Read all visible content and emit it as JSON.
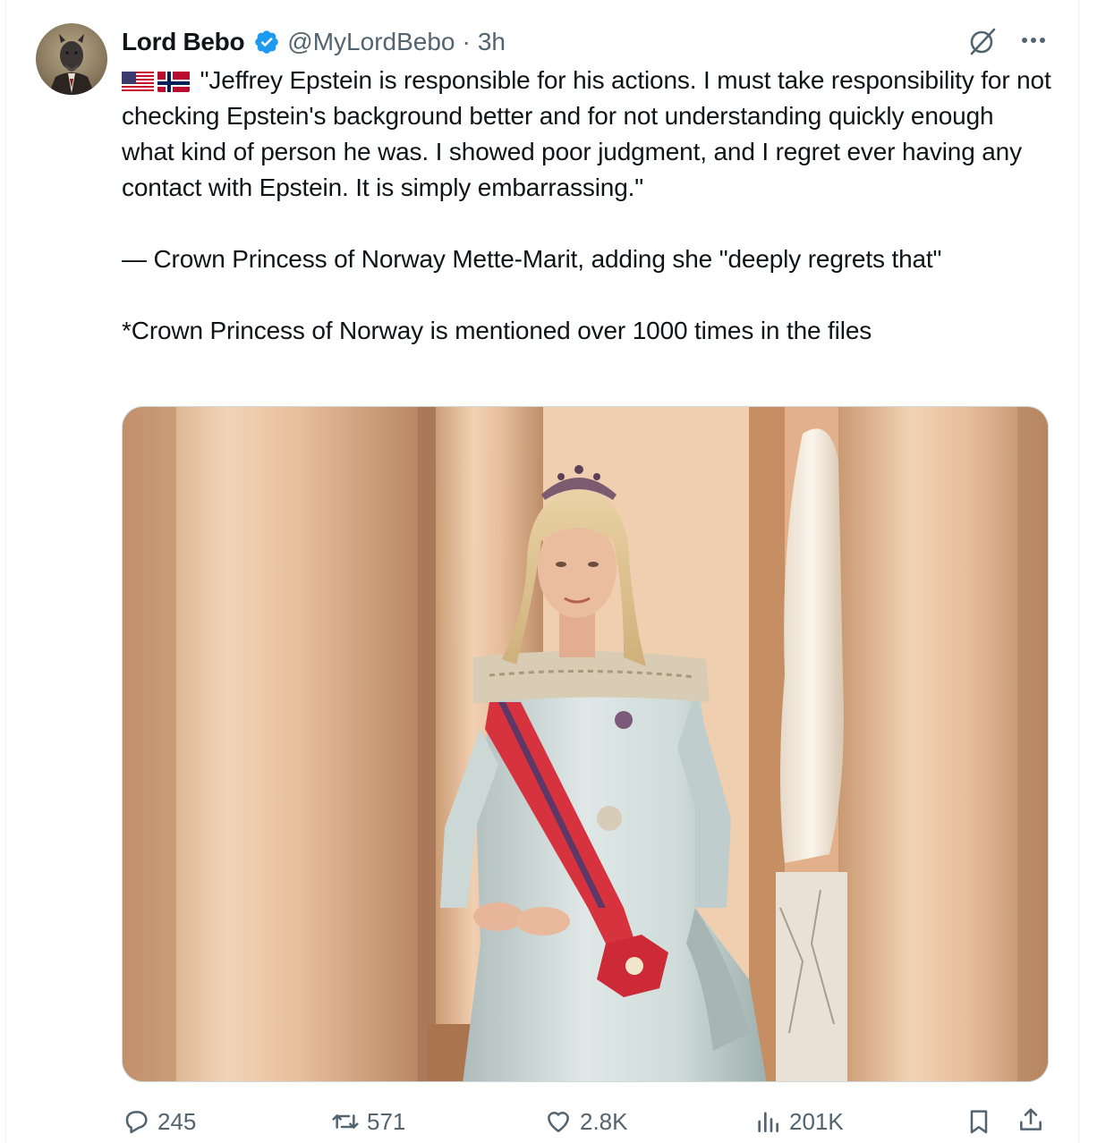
{
  "author": {
    "display_name": "Lord Bebo",
    "handle": "@MyLordBebo",
    "separator": "·",
    "time": "3h",
    "verified_color": "#1d9bf0"
  },
  "header_icons": [
    "grok-icon",
    "more-icon"
  ],
  "tweet": {
    "flags": [
      "us-flag-icon",
      "norway-flag-icon"
    ],
    "paragraph_1": "\"Jeffrey Epstein is responsible for his actions. I must take responsibility for not checking Epstein's background better and for not understanding quickly enough what kind of person he was. I showed poor judgment, and I regret ever having any contact with Epstein. It is simply embarrassing.\"",
    "paragraph_2": "— Crown Princess of Norway Mette-Marit, adding she \"deeply regrets that\"",
    "paragraph_3": "*Crown Princess of Norway is mentioned over 1000 times in the files"
  },
  "media": {
    "type": "photo",
    "subject": "woman-in-gown-with-tiara-and-sash"
  },
  "actions": {
    "replies": "245",
    "reposts": "571",
    "likes": "2.8K",
    "views": "201K"
  },
  "colors": {
    "text_primary": "#0f1419",
    "text_secondary": "#536471",
    "border": "#cfd9de"
  }
}
